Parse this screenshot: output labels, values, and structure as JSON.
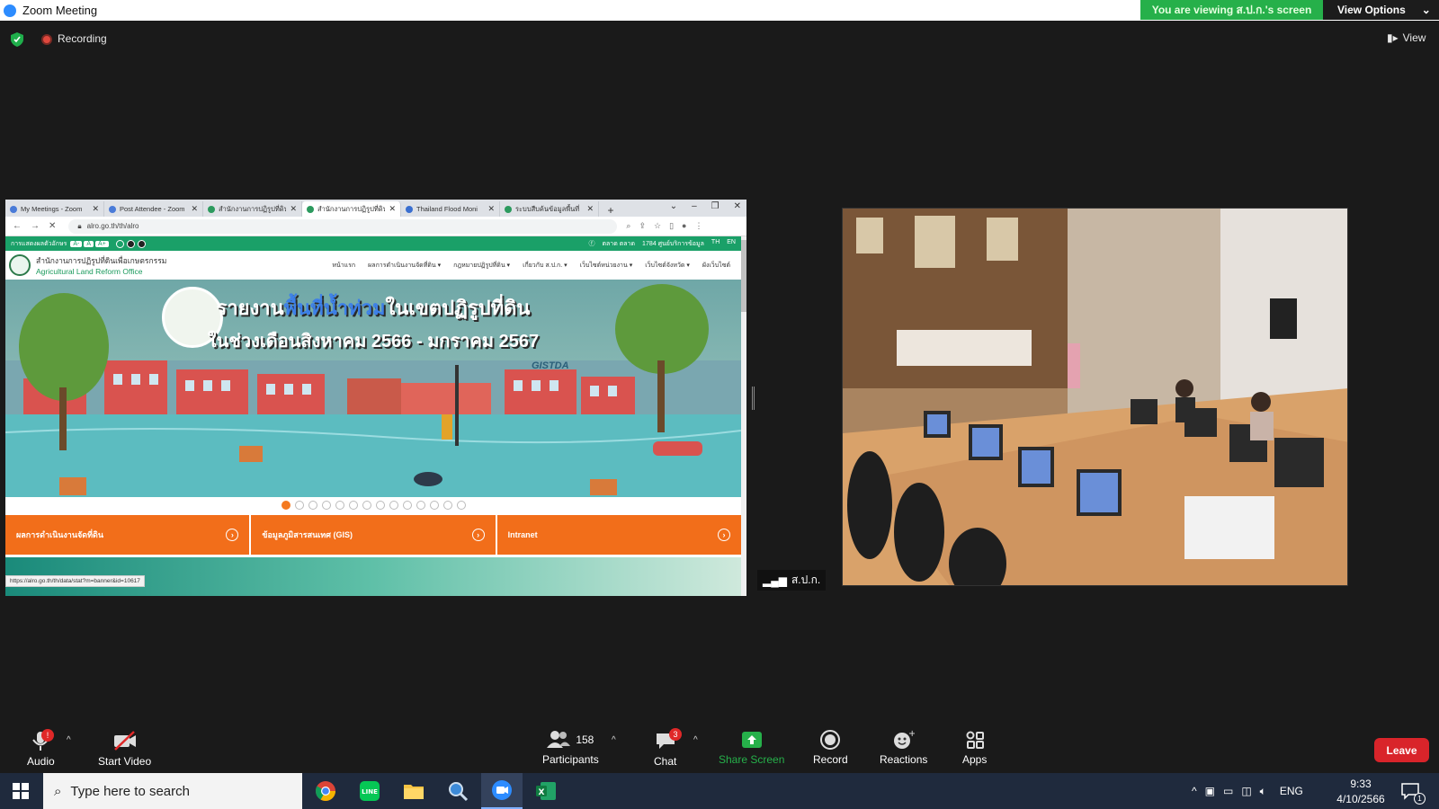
{
  "window": {
    "title": "Zoom Meeting"
  },
  "top": {
    "viewing_text": "You are viewing ส.ป.ก.'s screen",
    "view_options": "View Options",
    "recording": "Recording",
    "view": "View"
  },
  "browser": {
    "tabs": [
      {
        "label": "My Meetings - Zoom",
        "close": "✕"
      },
      {
        "label": "Post Attendee - Zoom",
        "close": "✕"
      },
      {
        "label": "สำนักงานการปฏิรูปที่ดิน",
        "close": "✕"
      },
      {
        "label": "สำนักงานการปฏิรูปที่ดิน",
        "close": "✕"
      },
      {
        "label": "Thailand Flood Moni",
        "close": "✕"
      },
      {
        "label": "ระบบสืบค้นข้อมูลพื้นที่",
        "close": "✕"
      }
    ],
    "new_tab": "+",
    "url": "alro.go.th/th/alro"
  },
  "site": {
    "access_label": "การแสดงผลตัวอักษร",
    "font_sizes": [
      "A-",
      "A",
      "A+"
    ],
    "account": "ตลาด ตลาด",
    "hotline": "1784 ศูนย์บริการข้อมูล",
    "lang": [
      "TH",
      "EN"
    ],
    "org_th": "สำนักงานการปฏิรูปที่ดินเพื่อเกษตรกรรม",
    "org_en": "Agricultural Land Reform Office",
    "menu": [
      "หน้าแรก",
      "ผลการดำเนินงานจัดที่ดิน ▾",
      "กฎหมายปฏิรูปที่ดิน ▾",
      "เกี่ยวกับ ส.ป.ก. ▾",
      "เว็บไซต์หน่วยงาน ▾",
      "เว็บไซต์จังหวัด ▾",
      "ผังเว็บไซต์"
    ],
    "banner_title_a": "รายงาน",
    "banner_title_b": "พื้นที่น้ำท่วม",
    "banner_title_c": "ในเขตปฏิรูปที่ดิน",
    "banner_subtitle": "ในช่วงเดือนสิงหาคม 2566 - มกราคม 2567",
    "banner_logo": "GISTDA",
    "slide_count": 14,
    "active_slide": 0,
    "cards": [
      {
        "label": "ผลการดำเนินงานจัดที่ดิน",
        "arrow": "›"
      },
      {
        "label": "ข้อมูลภูมิสารสนเทศ (GIS)",
        "arrow": "›"
      },
      {
        "label": "Intranet",
        "arrow": "›"
      }
    ],
    "status_url": "https://alro.go.th/th/data/stat?m=banner&id=10617"
  },
  "video": {
    "participant_name": "ส.ป.ก."
  },
  "toolbar": {
    "audio": "Audio",
    "audio_badge": "!",
    "start_video": "Start Video",
    "participants": "Participants",
    "participants_count": "158",
    "chat": "Chat",
    "chat_badge": "3",
    "share_screen": "Share Screen",
    "record": "Record",
    "reactions": "Reactions",
    "apps": "Apps",
    "leave": "Leave",
    "share_color": "#26b04a"
  },
  "taskbar": {
    "search_placeholder": "Type here to search",
    "language": "ENG",
    "time": "9:33",
    "date": "4/10/2566",
    "notification_count": "1"
  }
}
